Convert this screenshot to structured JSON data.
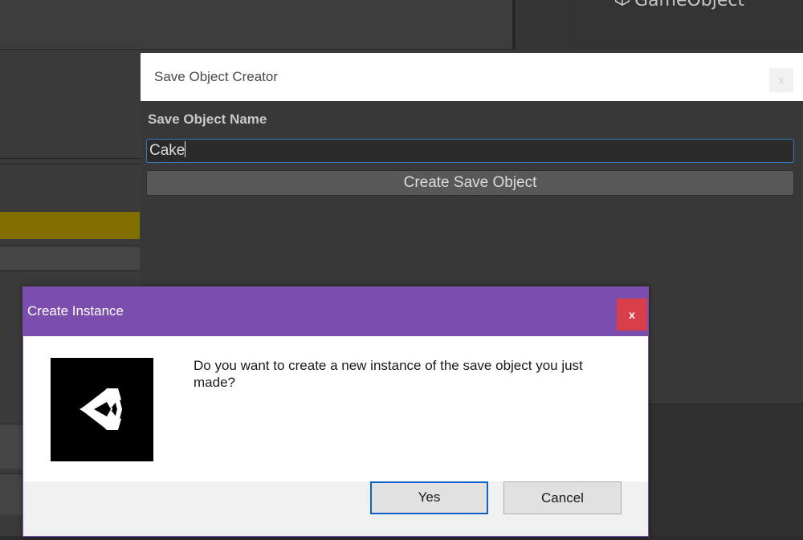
{
  "editor": {
    "inspector_header": "GameObject",
    "inspector_icon": "cube-icon",
    "accent_color": "#806e00"
  },
  "creator_window": {
    "title": "Save Object Creator",
    "close_label": "x",
    "field_label": "Save Object Name",
    "name_value": "Cake",
    "create_button_label": "Create Save Object"
  },
  "dialog": {
    "title": "Create Instance",
    "close_label": "x",
    "title_bar_color": "#7b4eae",
    "logo": "unity-logo-icon",
    "message": "Do you want to create a new instance of the save object you just made?",
    "yes_label": "Yes",
    "cancel_label": "Cancel"
  }
}
